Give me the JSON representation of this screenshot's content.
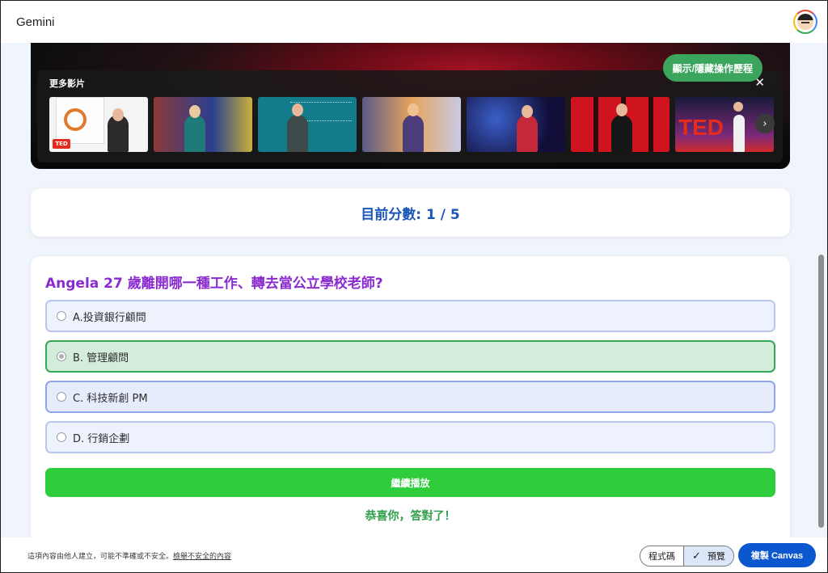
{
  "app": {
    "title": "Gemini"
  },
  "video": {
    "more_videos_label": "更多影片",
    "close_icon": "close-icon",
    "next_icon": "chevron-right-icon",
    "history_toggle_label": "顯示/隱藏操作歷程"
  },
  "score": {
    "text": "目前分數: 1 / 5"
  },
  "quiz": {
    "question": "Angela 27 歲離開哪一種工作、轉去當公立學校老師?",
    "options": [
      {
        "label": "A.投資銀行顧問",
        "state": "default"
      },
      {
        "label": "B. 管理顧問",
        "state": "correct"
      },
      {
        "label": "C. 科技新創 PM",
        "state": "hover"
      },
      {
        "label": "D. 行銷企劃",
        "state": "default"
      }
    ],
    "continue_label": "繼續播放",
    "feedback": "恭喜你，答對了！"
  },
  "footer": {
    "disclaimer": "這項內容由他人建立，可能不準確或不安全。",
    "report_link": "檢舉不安全的內容",
    "tab_code": "程式碼",
    "tab_preview": "預覽",
    "copy_button": "複製 Canvas"
  },
  "colors": {
    "accent_blue": "#0b57d0",
    "score_blue": "#1a56b8",
    "question_purple": "#8a2bd0",
    "continue_green": "#2fcd3c",
    "correct_bg": "#d4edda"
  }
}
